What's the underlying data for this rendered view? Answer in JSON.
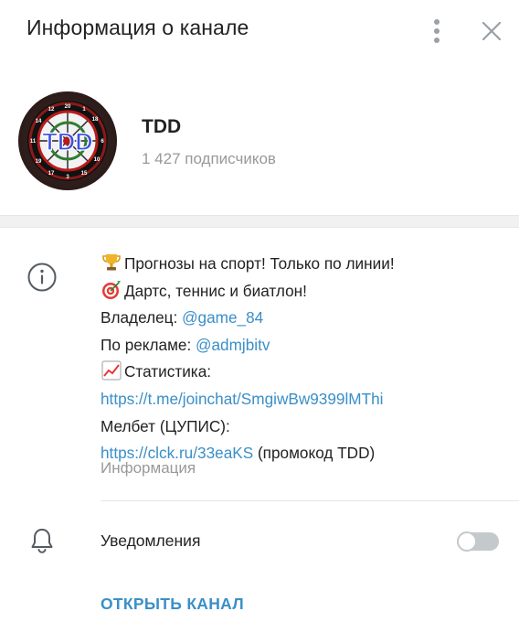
{
  "header": {
    "title": "Информация о канале",
    "more_icon": "more-vertical-icon",
    "close_icon": "close-icon"
  },
  "profile": {
    "name": "TDD",
    "subscribers": "1 427 подписчиков",
    "avatar_text": "TDD"
  },
  "info": {
    "icon": "info-icon",
    "description": {
      "line1": "Прогнозы на спорт! Только по линии!",
      "line2": "Дартс, теннис и биатлон!",
      "owner_label": "Владелец: ",
      "owner_link": "@game_84",
      "ads_label": "По рекламе: ",
      "ads_link": "@admjbitv",
      "stats_label": "Статистика:",
      "stats_link": "https://t.me/joinchat/SmgiwBw9399lMThi",
      "melbet_label": "Мелбет (ЦУПИС):",
      "melbet_link": "https://clck.ru/33eaKS",
      "promo_text": " (промокод TDD)"
    },
    "label": "Информация"
  },
  "notifications": {
    "icon": "bell-icon",
    "label": "Уведомления",
    "enabled": false
  },
  "actions": {
    "open_channel": "ОТКРЫТЬ КАНАЛ"
  },
  "colors": {
    "link": "#3a8fc8",
    "text": "#222222",
    "muted": "#999999",
    "toggle_off": "#c4c9cc"
  }
}
